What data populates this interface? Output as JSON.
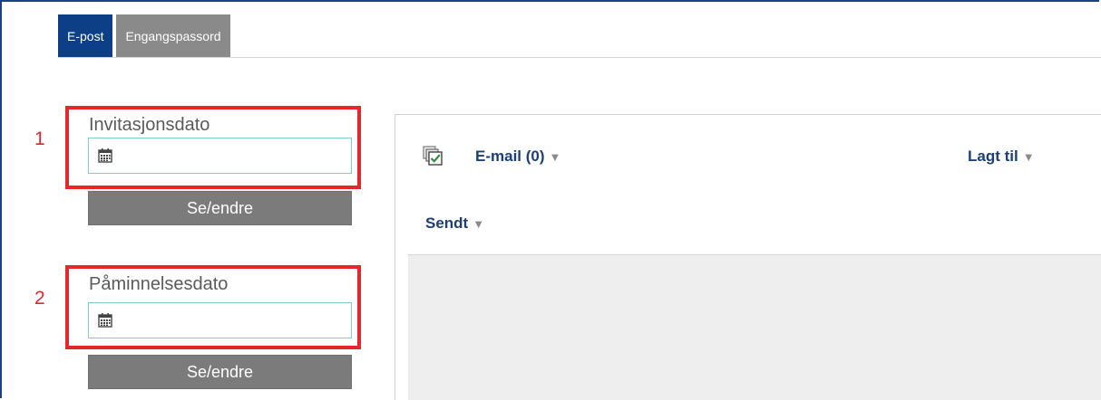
{
  "tabs": [
    {
      "label": "E-post",
      "active": true
    },
    {
      "label": "Engangspassord",
      "active": false
    }
  ],
  "fields": [
    {
      "number": "1",
      "label": "Invitasjonsdato",
      "value": "",
      "button": "Se/endre"
    },
    {
      "number": "2",
      "label": "Påminnelsesdato",
      "value": "",
      "button": "Se/endre"
    }
  ],
  "list": {
    "email_header": "E-mail (0)",
    "added_header": "Lagt til",
    "sent_header": "Sendt",
    "caret": "▼"
  },
  "colors": {
    "accent_blue": "#0d3f87",
    "highlight_red": "#e5262b",
    "input_border": "#79d1c6",
    "button_gray": "#7b7b7b"
  },
  "icons": {
    "field": "calendar-icon",
    "select": "select-all-icon"
  }
}
